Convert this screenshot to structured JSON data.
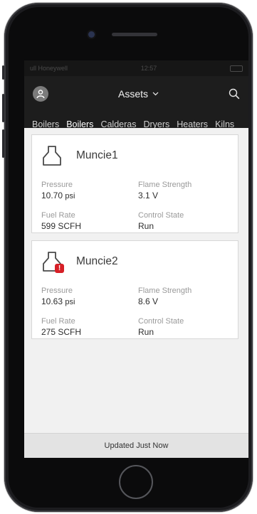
{
  "status_bar": {
    "carrier": "ull Honeywell",
    "time": "12:57"
  },
  "header": {
    "title": "Assets",
    "title_caret": "⌄"
  },
  "tabs": [
    {
      "label": "Boilers",
      "active": false
    },
    {
      "label": "Boilers",
      "active": true
    },
    {
      "label": "Calderas",
      "active": false
    },
    {
      "label": "Dryers",
      "active": false
    },
    {
      "label": "Heaters",
      "active": false
    },
    {
      "label": "Kilns",
      "active": false
    }
  ],
  "assets": [
    {
      "name": "Muncie1",
      "icon": "boiler-icon",
      "alert": false,
      "pressure_label": "Pressure",
      "pressure_value": "10.70",
      "pressure_unit": "psi",
      "flame_label": "Flame Strength",
      "flame_value": "3.1 V",
      "fuel_label": "Fuel Rate",
      "fuel_value": "599 SCFH",
      "control_label": "Control State",
      "control_value": "Run"
    },
    {
      "name": "Muncie2",
      "icon": "boiler-icon",
      "alert": true,
      "alert_glyph": "!",
      "pressure_label": "Pressure",
      "pressure_value": "10.63",
      "pressure_unit": "psi",
      "flame_label": "Flame Strength",
      "flame_value": "8.6 V",
      "fuel_label": "Fuel Rate",
      "fuel_value": "275 SCFH",
      "control_label": "Control State",
      "control_value": "Run"
    }
  ],
  "footer": {
    "updated_text": "Updated Just Now"
  },
  "colors": {
    "accent": "#2f8cf0",
    "alert": "#d61f26",
    "nav_bg": "#1d1d1d"
  }
}
